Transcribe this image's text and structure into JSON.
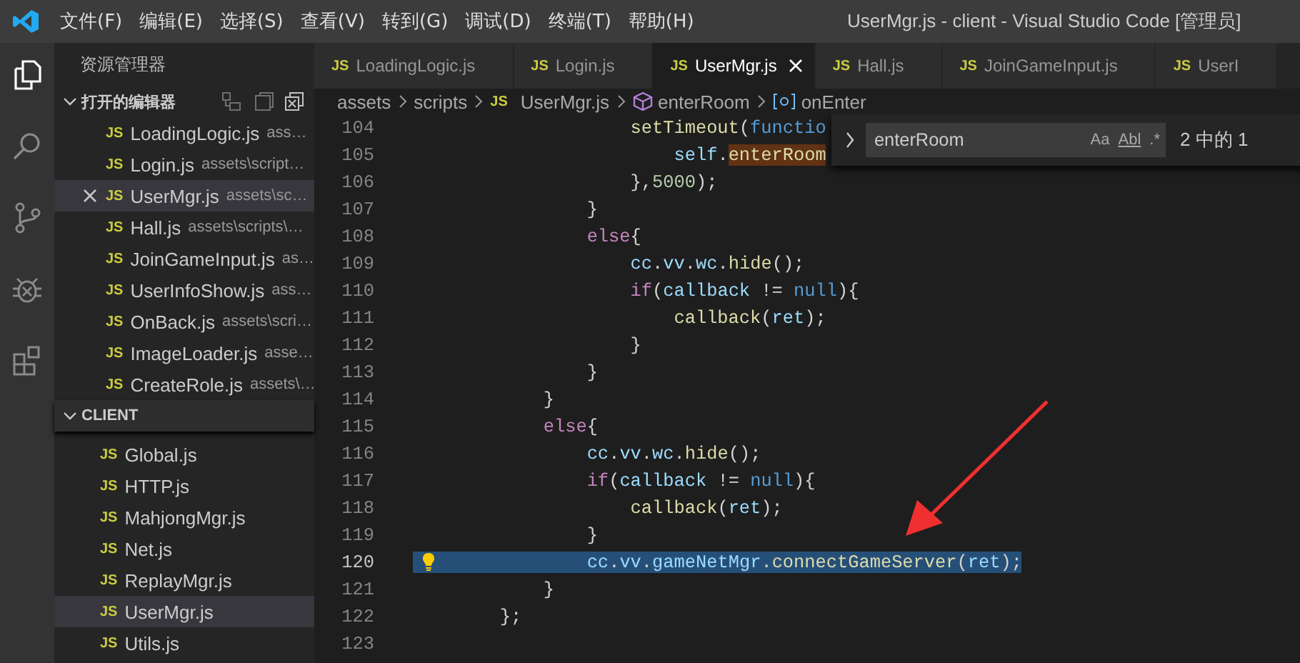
{
  "title_bar": {
    "menu": [
      "文件(F)",
      "编辑(E)",
      "选择(S)",
      "查看(V)",
      "转到(G)",
      "调试(D)",
      "终端(T)",
      "帮助(H)"
    ],
    "title": "UserMgr.js - client - Visual Studio Code [管理员]"
  },
  "activity_bar": [
    {
      "kind": "files",
      "selected": true
    },
    {
      "kind": "search",
      "selected": false
    },
    {
      "kind": "scm",
      "selected": false
    },
    {
      "kind": "debug",
      "selected": false
    },
    {
      "kind": "extensions",
      "selected": false
    }
  ],
  "sidebar": {
    "title": "资源管理器",
    "open_editors": {
      "label": "打开的编辑器",
      "expanded": true,
      "items": [
        {
          "icon": "JS",
          "name": "LoadingLogic.js",
          "path": "ass…",
          "selected": false
        },
        {
          "icon": "JS",
          "name": "Login.js",
          "path": "assets\\script…",
          "selected": false
        },
        {
          "icon": "JS",
          "name": "UserMgr.js",
          "path": "assets\\sc…",
          "selected": true
        },
        {
          "icon": "JS",
          "name": "Hall.js",
          "path": "assets\\scripts\\…",
          "selected": false
        },
        {
          "icon": "JS",
          "name": "JoinGameInput.js",
          "path": "as…",
          "selected": false
        },
        {
          "icon": "JS",
          "name": "UserInfoShow.js",
          "path": "ass…",
          "selected": false
        },
        {
          "icon": "JS",
          "name": "OnBack.js",
          "path": "assets\\scri…",
          "selected": false
        },
        {
          "icon": "JS",
          "name": "ImageLoader.js",
          "path": "asse…",
          "selected": false
        },
        {
          "icon": "JS",
          "name": "CreateRole.js",
          "path": "assets\\…",
          "selected": false
        }
      ]
    },
    "folder": {
      "label": "CLIENT",
      "expanded": true,
      "items": [
        {
          "icon": "JS",
          "name": "Global.js",
          "selected": false
        },
        {
          "icon": "JS",
          "name": "HTTP.js",
          "selected": false
        },
        {
          "icon": "JS",
          "name": "MahjongMgr.js",
          "selected": false
        },
        {
          "icon": "JS",
          "name": "Net.js",
          "selected": false
        },
        {
          "icon": "JS",
          "name": "ReplayMgr.js",
          "selected": false
        },
        {
          "icon": "JS",
          "name": "UserMgr.js",
          "selected": true
        },
        {
          "icon": "JS",
          "name": "Utils.js",
          "selected": false
        }
      ]
    }
  },
  "tabs": [
    {
      "icon": "JS",
      "label": "LoadingLogic.js",
      "selected": false
    },
    {
      "icon": "JS",
      "label": "Login.js",
      "selected": false
    },
    {
      "icon": "JS",
      "label": "UserMgr.js",
      "selected": true
    },
    {
      "icon": "JS",
      "label": "Hall.js",
      "selected": false
    },
    {
      "icon": "JS",
      "label": "JoinGameInput.js",
      "selected": false
    },
    {
      "icon": "JS",
      "label": "UserI",
      "selected": false
    }
  ],
  "breadcrumbs": [
    {
      "label": "assets",
      "kind": "folder"
    },
    {
      "label": "scripts",
      "kind": "folder"
    },
    {
      "icon": "JS",
      "label": "UserMgr.js",
      "kind": "file"
    },
    {
      "label": "enterRoom",
      "kind": "method"
    },
    {
      "label": "onEnter",
      "kind": "variable"
    }
  ],
  "code_lines": [
    {
      "number": "104",
      "tokens": [
        {
          "text": "                    setTimeout",
          "kind": "fn"
        },
        {
          "text": "(",
          "kind": "p"
        },
        {
          "text": "functio",
          "kind": "kw2"
        }
      ],
      "selected": false,
      "lightbulb": false
    },
    {
      "number": "105",
      "tokens": [
        {
          "text": "                        self",
          "kind": "var"
        },
        {
          "text": ".",
          "kind": "p"
        },
        {
          "text": "enterRoom",
          "kind": "fn",
          "match": true
        }
      ],
      "selected": false,
      "lightbulb": false
    },
    {
      "number": "106",
      "tokens": [
        {
          "text": "                    },",
          "kind": "p"
        },
        {
          "text": "5000",
          "kind": "num"
        },
        {
          "text": ");",
          "kind": "p"
        }
      ],
      "selected": false,
      "lightbulb": false
    },
    {
      "number": "107",
      "tokens": [
        {
          "text": "                }",
          "kind": "p"
        }
      ],
      "selected": false,
      "lightbulb": false
    },
    {
      "number": "108",
      "tokens": [
        {
          "text": "                else",
          "kind": "kw"
        },
        {
          "text": "{",
          "kind": "p"
        }
      ],
      "selected": false,
      "lightbulb": false
    },
    {
      "number": "109",
      "tokens": [
        {
          "text": "                    cc",
          "kind": "var"
        },
        {
          "text": ".",
          "kind": "p"
        },
        {
          "text": "vv",
          "kind": "var"
        },
        {
          "text": ".",
          "kind": "p"
        },
        {
          "text": "wc",
          "kind": "var"
        },
        {
          "text": ".",
          "kind": "p"
        },
        {
          "text": "hide",
          "kind": "fn"
        },
        {
          "text": "();",
          "kind": "p"
        }
      ],
      "selected": false,
      "lightbulb": false
    },
    {
      "number": "110",
      "tokens": [
        {
          "text": "                    if",
          "kind": "kw"
        },
        {
          "text": "(",
          "kind": "p"
        },
        {
          "text": "callback",
          "kind": "var"
        },
        {
          "text": " != ",
          "kind": "p"
        },
        {
          "text": "null",
          "kind": "kw2"
        },
        {
          "text": "){",
          "kind": "p"
        }
      ],
      "selected": false,
      "lightbulb": false
    },
    {
      "number": "111",
      "tokens": [
        {
          "text": "                        callback",
          "kind": "fn"
        },
        {
          "text": "(",
          "kind": "p"
        },
        {
          "text": "ret",
          "kind": "var"
        },
        {
          "text": ");",
          "kind": "p"
        }
      ],
      "selected": false,
      "lightbulb": false
    },
    {
      "number": "112",
      "tokens": [
        {
          "text": "                    }",
          "kind": "p"
        }
      ],
      "selected": false,
      "lightbulb": false
    },
    {
      "number": "113",
      "tokens": [
        {
          "text": "                }",
          "kind": "p"
        }
      ],
      "selected": false,
      "lightbulb": false
    },
    {
      "number": "114",
      "tokens": [
        {
          "text": "            }",
          "kind": "p"
        }
      ],
      "selected": false,
      "lightbulb": false
    },
    {
      "number": "115",
      "tokens": [
        {
          "text": "            else",
          "kind": "kw"
        },
        {
          "text": "{",
          "kind": "p"
        }
      ],
      "selected": false,
      "lightbulb": false
    },
    {
      "number": "116",
      "tokens": [
        {
          "text": "                cc",
          "kind": "var"
        },
        {
          "text": ".",
          "kind": "p"
        },
        {
          "text": "vv",
          "kind": "var"
        },
        {
          "text": ".",
          "kind": "p"
        },
        {
          "text": "wc",
          "kind": "var"
        },
        {
          "text": ".",
          "kind": "p"
        },
        {
          "text": "hide",
          "kind": "fn"
        },
        {
          "text": "();",
          "kind": "p"
        }
      ],
      "selected": false,
      "lightbulb": false
    },
    {
      "number": "117",
      "tokens": [
        {
          "text": "                if",
          "kind": "kw"
        },
        {
          "text": "(",
          "kind": "p"
        },
        {
          "text": "callback",
          "kind": "var"
        },
        {
          "text": " != ",
          "kind": "p"
        },
        {
          "text": "null",
          "kind": "kw2"
        },
        {
          "text": "){",
          "kind": "p"
        }
      ],
      "selected": false,
      "lightbulb": false
    },
    {
      "number": "118",
      "tokens": [
        {
          "text": "                    callback",
          "kind": "fn"
        },
        {
          "text": "(",
          "kind": "p"
        },
        {
          "text": "ret",
          "kind": "var"
        },
        {
          "text": ");",
          "kind": "p"
        }
      ],
      "selected": false,
      "lightbulb": false
    },
    {
      "number": "119",
      "tokens": [
        {
          "text": "                }",
          "kind": "p"
        }
      ],
      "selected": false,
      "lightbulb": false
    },
    {
      "number": "120",
      "tokens": [
        {
          "text": "                cc",
          "kind": "var"
        },
        {
          "text": ".",
          "kind": "p"
        },
        {
          "text": "vv",
          "kind": "var"
        },
        {
          "text": ".",
          "kind": "p"
        },
        {
          "text": "gameNetMgr",
          "kind": "var"
        },
        {
          "text": ".",
          "kind": "p"
        },
        {
          "text": "connectGameServer",
          "kind": "fn"
        },
        {
          "text": "(",
          "kind": "p"
        },
        {
          "text": "ret",
          "kind": "var"
        },
        {
          "text": ");",
          "kind": "p"
        }
      ],
      "selected": true,
      "lightbulb": true
    },
    {
      "number": "121",
      "tokens": [
        {
          "text": "            }",
          "kind": "p"
        }
      ],
      "selected": false,
      "lightbulb": false
    },
    {
      "number": "122",
      "tokens": [
        {
          "text": "        };",
          "kind": "p"
        }
      ],
      "selected": false,
      "lightbulb": false
    },
    {
      "number": "123",
      "selected": false,
      "lightbulb": false
    }
  ],
  "find_widget": {
    "expanded": false,
    "value": "enterRoom",
    "match_case": "Aa",
    "whole_word": "Abl",
    "regex": ".*",
    "count": "2 中的 1"
  }
}
